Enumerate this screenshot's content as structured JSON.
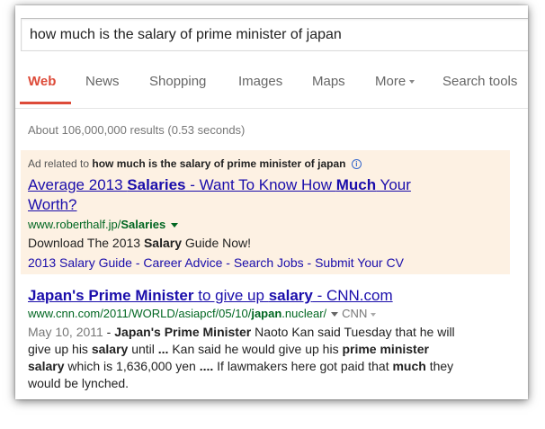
{
  "search": {
    "query": "how much is the salary of prime minister of japan"
  },
  "tabs": [
    {
      "label": "Web",
      "active": true
    },
    {
      "label": "News"
    },
    {
      "label": "Shopping"
    },
    {
      "label": "Images"
    },
    {
      "label": "Maps"
    },
    {
      "label": "More"
    },
    {
      "label": "Search tools"
    }
  ],
  "stats": "About 106,000,000 results (0.53 seconds)",
  "ad": {
    "label_prefix": "Ad related to",
    "label_query": "how much is the salary of prime minister of japan",
    "info_glyph": "i",
    "title_parts": [
      "Average 2013 ",
      "Salaries",
      " - Want To Know How ",
      "Much",
      " Your Worth?"
    ],
    "url_prefix": "www.roberthalf.jp/",
    "url_bold": "Salaries",
    "desc_parts": [
      "Download The 2013 ",
      "Salary",
      " Guide Now!"
    ],
    "sitelinks": [
      "2013 Salary Guide",
      "Career Advice",
      "Search Jobs",
      "Submit Your CV"
    ],
    "sitelink_separator": " - "
  },
  "result": {
    "title_parts": [
      "Japan's Prime Minister",
      " to give up ",
      "salary",
      " - CNN.com"
    ],
    "url_prefix": "www.cnn.com/2011/WORLD/asiapcf/05/10/",
    "url_bold": "japan",
    "url_suffix": ".nuclear/",
    "source": "CNN",
    "snippet_date": "May 10, 2011",
    "snippet_parts": [
      " - ",
      "Japan's Prime Minister",
      " Naoto Kan said Tuesday that he will give up his ",
      "salary",
      " until ",
      "...",
      " Kan said he would give up his ",
      "prime minister salary",
      " which is 1,636,000 yen ",
      "....",
      " If lawmakers here got paid that ",
      "much",
      " they would be lynched."
    ]
  },
  "colors": {
    "active_tab": "#dd4b39",
    "link": "#1a0dab",
    "url_green": "#006621",
    "ad_background": "#fdf1e3"
  }
}
